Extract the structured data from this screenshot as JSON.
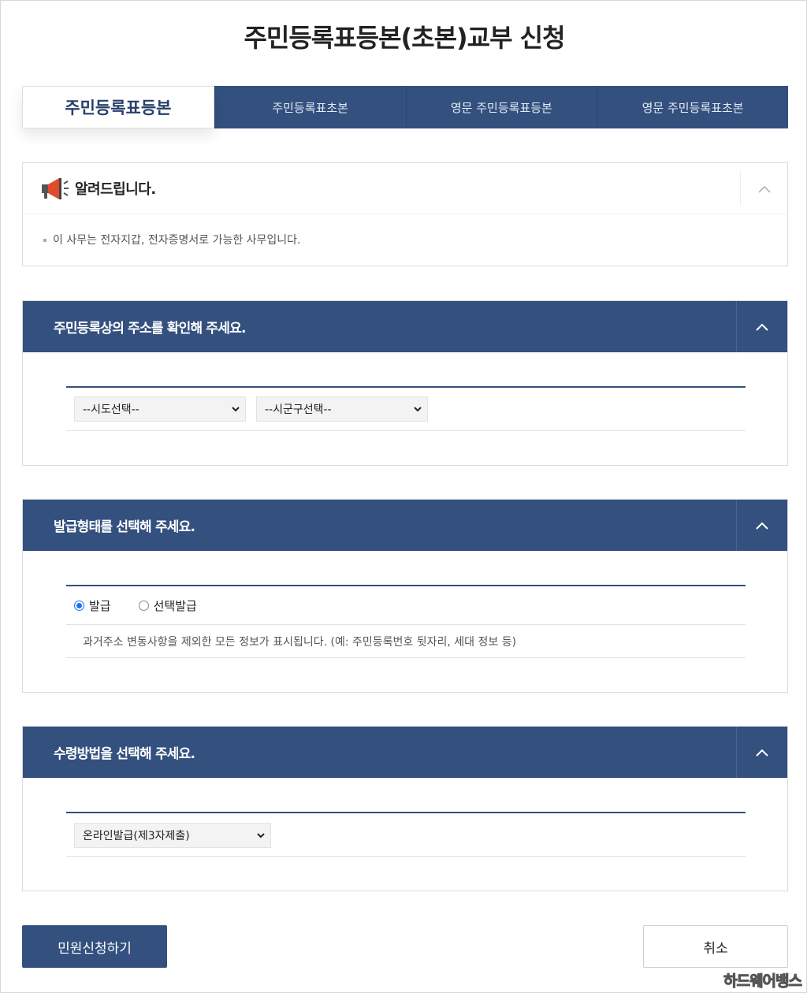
{
  "page": {
    "title": "주민등록표등본(초본)교부 신청"
  },
  "tabs": [
    {
      "label": "주민등록표등본",
      "active": true
    },
    {
      "label": "주민등록표초본",
      "active": false
    },
    {
      "label": "영문 주민등록표등본",
      "active": false
    },
    {
      "label": "영문 주민등록표초본",
      "active": false
    }
  ],
  "notice": {
    "title": "알려드립니다.",
    "text": "이 사무는 전자지갑, 전자증명서로 가능한 사무입니다."
  },
  "address_section": {
    "title": "주민등록상의 주소를 확인해 주세요.",
    "sido_select": "--시도선택--",
    "sigungu_select": "--시군구선택--"
  },
  "issue_type_section": {
    "title": "발급형태를 선택해 주세요.",
    "options": [
      {
        "label": "발급",
        "checked": true
      },
      {
        "label": "선택발급",
        "checked": false
      }
    ],
    "description": "과거주소 변동사항을 제외한 모든 정보가 표시됩니다. (예: 주민등록번호 뒷자리, 세대 정보 등)"
  },
  "receive_section": {
    "title": "수령방법을 선택해 주세요.",
    "method_select": "온라인발급(제3자제출)"
  },
  "buttons": {
    "submit": "민원신청하기",
    "cancel": "취소"
  },
  "watermark": "하드웨어뱅스",
  "colors": {
    "primary": "#33507f",
    "radio": "#1a73e8"
  }
}
